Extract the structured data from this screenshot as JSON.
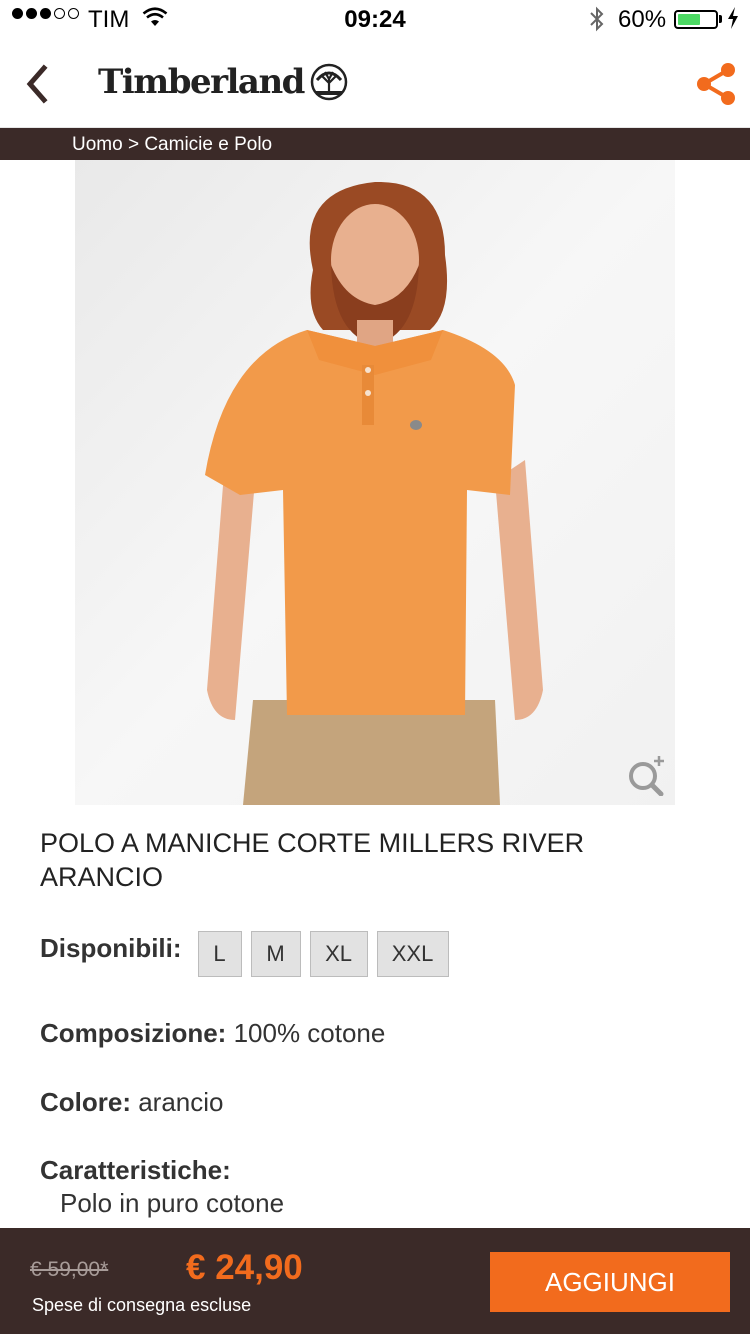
{
  "status_bar": {
    "carrier": "TIM",
    "time": "09:24",
    "battery_percent": "60%",
    "battery_level": 0.6,
    "signal_bars_filled": 3,
    "signal_bars_total": 5,
    "icons": [
      "wifi-icon",
      "bluetooth-icon",
      "battery-icon",
      "charging-bolt-icon"
    ]
  },
  "header": {
    "brand": "Timberland",
    "left_icon": "chevron-left-icon",
    "right_icon": "share-icon",
    "accent_color": "#f26b1d"
  },
  "breadcrumb": {
    "text": "Uomo > Camicie e Polo"
  },
  "product": {
    "image_icon": "zoom-in-icon",
    "title": "POLO A MANICHE CORTE MILLERS RIVER ARANCIO",
    "sizes_label": "Disponibili:",
    "sizes": [
      "L",
      "M",
      "XL",
      "XXL"
    ],
    "composition_label": "Composizione:",
    "composition_value": " 100% cotone",
    "color_label": "Colore:",
    "color_value": " arancio",
    "features_label": "Caratteristiche:",
    "features_first": "Polo in puro cotone"
  },
  "purchase": {
    "old_price": "€ 59,00*",
    "price": "€ 24,90",
    "shipping_note": "Spese di consegna escluse",
    "add_label": "AGGIUNGI"
  },
  "colors": {
    "dark_brown": "#3b2a28",
    "orange": "#f26b1d",
    "chip_bg": "#e2e2e2"
  }
}
